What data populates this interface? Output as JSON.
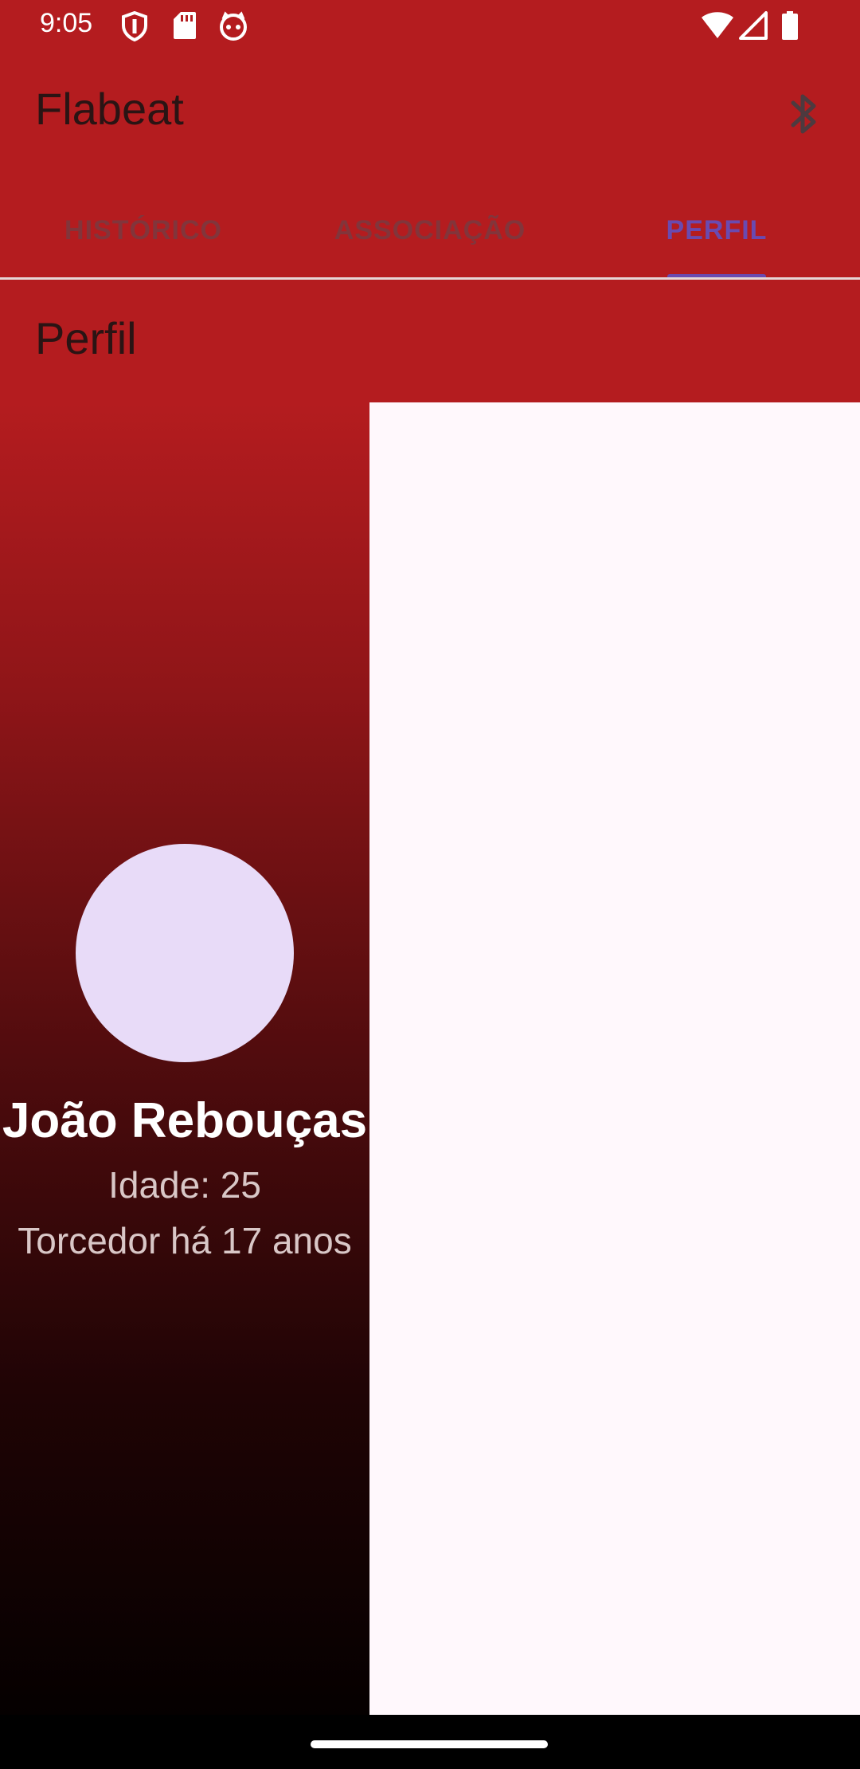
{
  "status_bar": {
    "time": "9:05",
    "left_icons": [
      "shield-icon",
      "sd-card-icon",
      "face-icon"
    ],
    "right_icons": [
      "wifi-icon",
      "signal-icon",
      "battery-icon"
    ]
  },
  "app_bar": {
    "title": "Flabeat",
    "action_icon": "bluetooth-icon"
  },
  "tabs": [
    {
      "label": "HISTÓRICO",
      "selected": false
    },
    {
      "label": "ASSOCIAÇÃO",
      "selected": false
    },
    {
      "label": "PERFIL",
      "selected": true
    }
  ],
  "section": {
    "title": "Perfil"
  },
  "profile": {
    "name": "João Rebouças",
    "age": "Idade: 25",
    "fan_since": "Torcedor há 17 anos"
  },
  "colors": {
    "primary": "#b41c1f",
    "tab_selected": "#6a4ab0",
    "avatar": "#e8dbf8",
    "content_bg": "#fff8fc"
  }
}
